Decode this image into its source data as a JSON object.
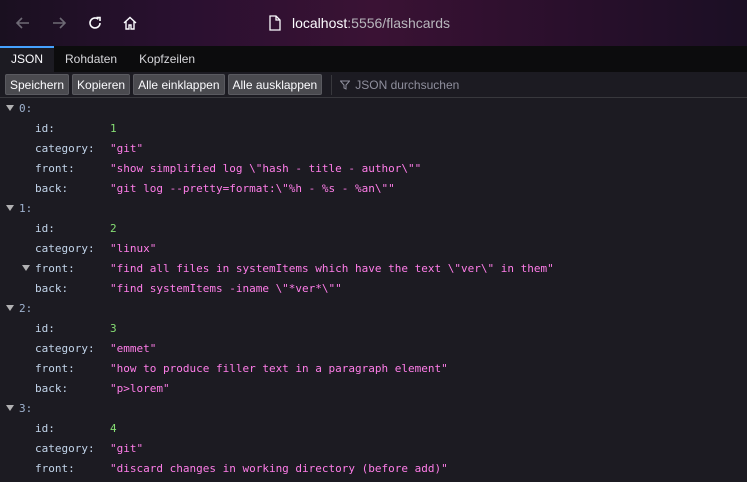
{
  "browser": {
    "url_host": "localhost",
    "url_rest": ":5556/flashcards"
  },
  "viewer_tabs": [
    "JSON",
    "Rohdaten",
    "Kopfzeilen"
  ],
  "toolbar": {
    "save": "Speichern",
    "copy": "Kopieren",
    "collapse_all": "Alle einklappen",
    "expand_all": "Alle ausklappen",
    "filter_placeholder": "JSON durchsuchen"
  },
  "items": [
    {
      "index": "0:",
      "fields": [
        {
          "key": "id:",
          "value": "1",
          "type": "number"
        },
        {
          "key": "category:",
          "value": "\"git\"",
          "type": "string"
        },
        {
          "key": "front:",
          "value": "\"show simplified log \\\"hash - title - author\\\"\"",
          "type": "string"
        },
        {
          "key": "back:",
          "value": "\"git log --pretty=format:\\\"%h - %s - %an\\\"\"",
          "type": "string"
        }
      ]
    },
    {
      "index": "1:",
      "fields": [
        {
          "key": "id:",
          "value": "2",
          "type": "number"
        },
        {
          "key": "category:",
          "value": "\"linux\"",
          "type": "string"
        },
        {
          "key": "front:",
          "value": "\"find all files in systemItems which have the text \\\"ver\\\" in them\"",
          "type": "string",
          "expanded_twisty": true
        },
        {
          "key": "back:",
          "value": "\"find systemItems -iname \\\"*ver*\\\"\"",
          "type": "string"
        }
      ]
    },
    {
      "index": "2:",
      "fields": [
        {
          "key": "id:",
          "value": "3",
          "type": "number"
        },
        {
          "key": "category:",
          "value": "\"emmet\"",
          "type": "string"
        },
        {
          "key": "front:",
          "value": "\"how to produce filler text in a paragraph element\"",
          "type": "string"
        },
        {
          "key": "back:",
          "value": "\"p>lorem\"",
          "type": "string"
        }
      ]
    },
    {
      "index": "3:",
      "fields": [
        {
          "key": "id:",
          "value": "4",
          "type": "number"
        },
        {
          "key": "category:",
          "value": "\"git\"",
          "type": "string"
        },
        {
          "key": "front:",
          "value": "\"discard changes in working directory (before add)\"",
          "type": "string"
        }
      ]
    }
  ]
}
